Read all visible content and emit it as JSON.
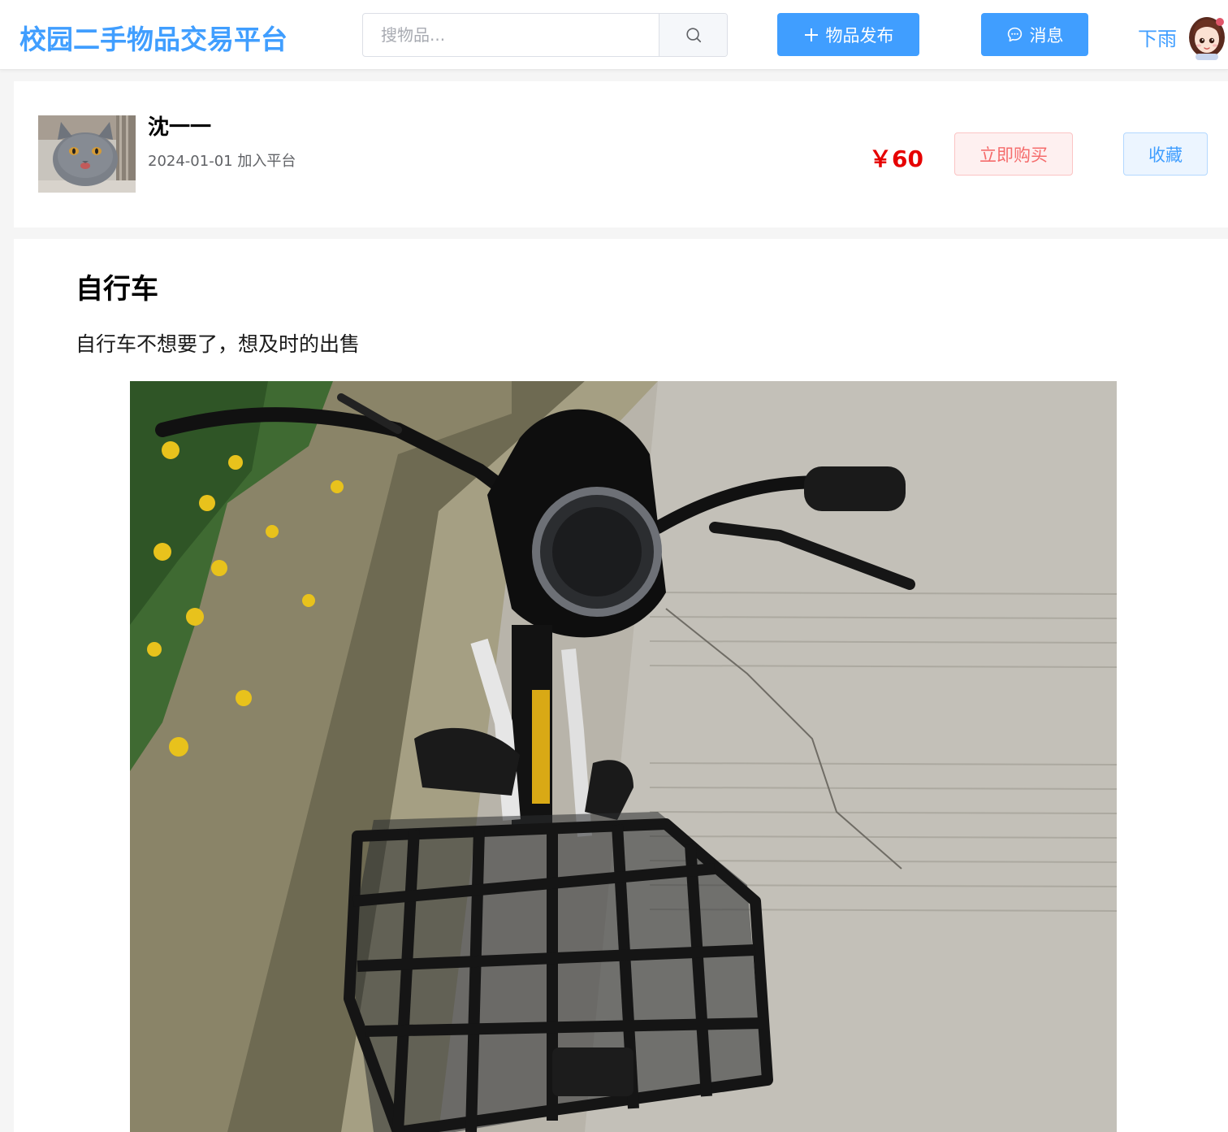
{
  "header": {
    "logo": "校园二手物品交易平台",
    "search_placeholder": "搜物品...",
    "publish_label": "物品发布",
    "message_label": "消息",
    "username": "下雨"
  },
  "seller": {
    "name": "沈一一",
    "join_text": "2024-01-01 加入平台"
  },
  "product": {
    "price": "￥60",
    "buy_label": "立即购买",
    "favorite_label": "收藏",
    "title": "自行车",
    "description": "自行车不想要了，想及时的出售"
  },
  "colors": {
    "accent": "#409eff",
    "price": "#e60000",
    "danger": "#f56c6c"
  }
}
